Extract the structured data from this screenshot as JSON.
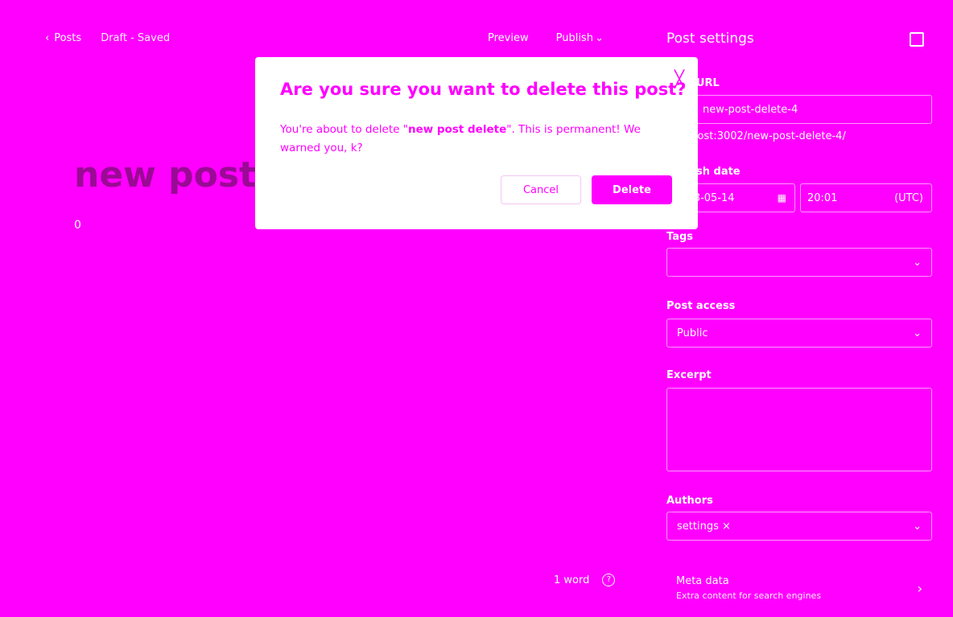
{
  "topbar": {
    "back_label": "Posts",
    "back_icon": "chevron-left-icon",
    "status": "Draft - Saved",
    "preview_label": "Preview",
    "publish_label": "Publish"
  },
  "editor": {
    "title": "new post delete",
    "body": "0",
    "word_count": "1 word",
    "help_icon": "question-circle-icon"
  },
  "sidebar": {
    "title": "Post settings",
    "post_url_label": "Post URL",
    "post_url_value": "new-post-delete-4",
    "url_full": "localhost:3002/new-post-delete-4/",
    "publish_date_label": "Publish date",
    "date_value": "2023-05-14",
    "time_value": "20:01",
    "timezone": "(UTC)",
    "tags_label": "Tags",
    "post_access_label": "Post access",
    "post_access_value": "Public",
    "excerpt_label": "Excerpt",
    "authors_label": "Authors",
    "author_name": "settings",
    "meta_title": "Meta data",
    "meta_sub": "Extra content for search engines"
  },
  "modal": {
    "title": "Are you sure you want to delete this post?",
    "body_prefix": "You're about to delete \"",
    "body_bold": "new post delete",
    "body_suffix": "\". This is permanent! We warned you, k?",
    "cancel_label": "Cancel",
    "delete_label": "Delete"
  },
  "colors": {
    "background": "#ff00ff",
    "modal_bg": "#ffffff",
    "accent": "#ff00ff",
    "title_color": "#9a0a95"
  }
}
